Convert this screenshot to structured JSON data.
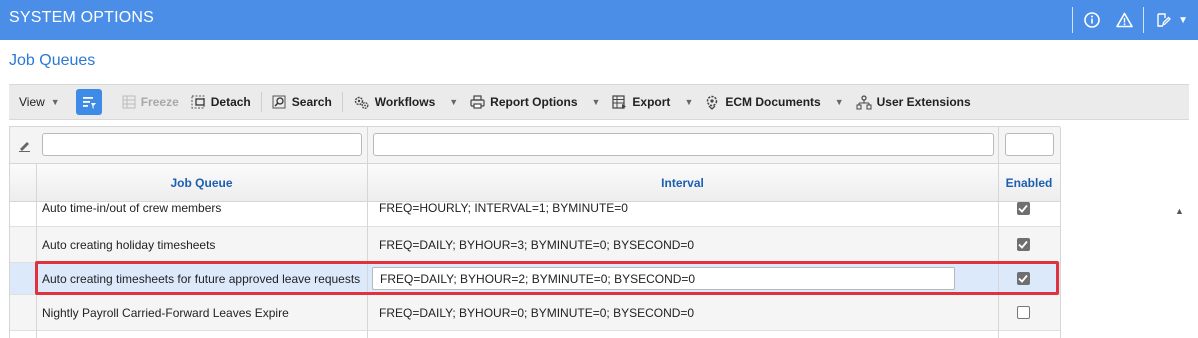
{
  "titlebar": {
    "title": "SYSTEM OPTIONS",
    "icons": [
      "info-icon",
      "warning-icon",
      "edit-note-icon",
      "chevron-down-icon"
    ]
  },
  "section": {
    "title": "Job Queues"
  },
  "toolbar": {
    "view_label": "View",
    "freeze_label": "Freeze",
    "detach_label": "Detach",
    "search_label": "Search",
    "workflows_label": "Workflows",
    "report_options_label": "Report Options",
    "export_label": "Export",
    "ecm_documents_label": "ECM Documents",
    "user_extensions_label": "User Extensions"
  },
  "grid": {
    "filters": {
      "job_queue": "",
      "interval": "",
      "enabled": ""
    },
    "columns": [
      "Job Queue",
      "Interval",
      "Enabled"
    ],
    "rows": [
      {
        "job_queue": "Auto time-in/out of crew members",
        "interval": "FREQ=HOURLY; INTERVAL=1; BYMINUTE=0",
        "enabled": true
      },
      {
        "job_queue": "Auto creating holiday timesheets",
        "interval": "FREQ=DAILY; BYHOUR=3; BYMINUTE=0; BYSECOND=0",
        "enabled": true
      },
      {
        "job_queue": "Auto creating timesheets for future approved leave requests",
        "interval": "FREQ=DAILY; BYHOUR=2; BYMINUTE=0; BYSECOND=0",
        "enabled": true
      },
      {
        "job_queue": "Nightly Payroll Carried-Forward Leaves Expire",
        "interval": "FREQ=DAILY; BYHOUR=0; BYMINUTE=0; BYSECOND=0",
        "enabled": false
      }
    ]
  },
  "colors": {
    "brand": "#4a8ee8",
    "section_title": "#2b78d6",
    "highlight": "#e0323d",
    "selected_row": "#dce9fb"
  }
}
